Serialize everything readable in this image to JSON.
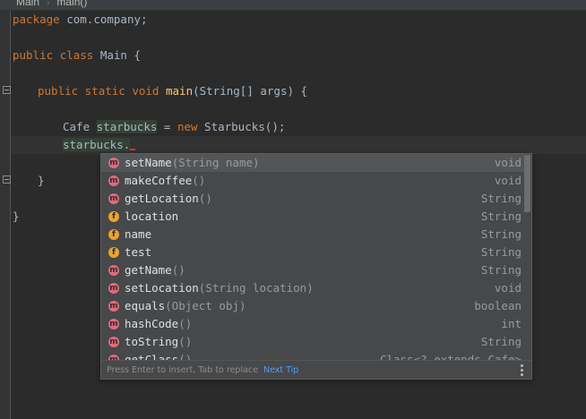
{
  "breadcrumb": {
    "items": [
      "Main",
      "main()"
    ]
  },
  "editor": {
    "package_kw": "package",
    "package_name": " com.company;",
    "class_kw": "public class",
    "class_name": " Main {",
    "method_kw": "public static void",
    "method_name": "main",
    "method_params": "(String[] args) {",
    "decl_type": "Cafe ",
    "decl_var": "starbucks",
    "decl_eq": " = ",
    "decl_new": "new",
    "decl_ctor": " Starbucks();",
    "current_text": "starbucks.",
    "close_method": "}",
    "close_class": "}"
  },
  "completion": {
    "items": [
      {
        "kind": "m",
        "name": "setName",
        "params": "(String name)",
        "type": "void"
      },
      {
        "kind": "m",
        "name": "makeCoffee",
        "params": "()",
        "type": "void"
      },
      {
        "kind": "m",
        "name": "getLocation",
        "params": "()",
        "type": "String"
      },
      {
        "kind": "f",
        "name": "location",
        "params": "",
        "type": "String"
      },
      {
        "kind": "f",
        "name": "name",
        "params": "",
        "type": "String"
      },
      {
        "kind": "f",
        "name": "test",
        "params": "",
        "type": "String"
      },
      {
        "kind": "m",
        "name": "getName",
        "params": "()",
        "type": "String"
      },
      {
        "kind": "m",
        "name": "setLocation",
        "params": "(String location)",
        "type": "void"
      },
      {
        "kind": "m",
        "name": "equals",
        "params": "(Object obj)",
        "type": "boolean"
      },
      {
        "kind": "m",
        "name": "hashCode",
        "params": "()",
        "type": "int"
      },
      {
        "kind": "m",
        "name": "toString",
        "params": "()",
        "type": "String"
      },
      {
        "kind": "m",
        "name": "getClass",
        "params": "()",
        "type": "Class<? extends Cafe>"
      }
    ],
    "footer_hint": "Press Enter to insert, Tab to replace",
    "next_tip": "Next Tip"
  },
  "icons": {
    "method_badge": "m",
    "field_badge": "f",
    "more": "more-vertical-icon",
    "fold": "fold-marker-icon"
  }
}
